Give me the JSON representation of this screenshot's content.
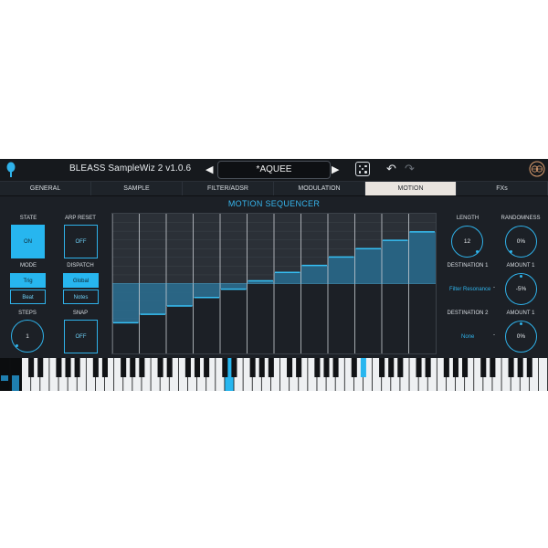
{
  "app": {
    "title": "BLEASS SampleWiz 2  v1.0.6",
    "preset_name": "*AQUEE",
    "prev_arrow": "◀",
    "next_arrow": "▶",
    "icons": [
      "logo-icon",
      "dice-icon",
      "undo-icon",
      "redo-icon",
      "brand-logo-icon"
    ],
    "accent_color": "#27b6ef"
  },
  "tabs": [
    {
      "label": "GENERAL",
      "active": false
    },
    {
      "label": "SAMPLE",
      "active": false
    },
    {
      "label": "FILTER/ADSR",
      "active": false
    },
    {
      "label": "MODULATION",
      "active": false
    },
    {
      "label": "MOTION",
      "active": true
    },
    {
      "label": "FXs",
      "active": false
    }
  ],
  "left": {
    "state_label": "STATE",
    "state_value": "ON",
    "arp_reset_label": "ARP RESET",
    "arp_reset_value": "OFF",
    "mode_label": "MODE",
    "mode_options": [
      "Trig",
      "Beat"
    ],
    "mode_selected": "Trig",
    "dispatch_label": "DISPATCH",
    "dispatch_options": [
      "Global",
      "Notes"
    ],
    "dispatch_selected": "Global",
    "steps_label": "STEPS",
    "steps_value": "1",
    "snap_label": "SNAP",
    "snap_value": "OFF"
  },
  "sequencer": {
    "title": "MOTION SEQUENCER",
    "center_line": 0.5,
    "steps": [
      0.22,
      0.28,
      0.34,
      0.4,
      0.46,
      0.52,
      0.58,
      0.63,
      0.69,
      0.75,
      0.81,
      0.87
    ]
  },
  "right": {
    "length_label": "LENGTH",
    "length_value": "12",
    "randomness_label": "RANDOMNESS",
    "randomness_value": "0%",
    "dest1_label": "DESTINATION 1",
    "dest1_value": "Filter Resonance",
    "amount1_label": "AMOUNT 1",
    "amount1_value": "-5%",
    "dest2_label": "DESTINATION 2",
    "dest2_value": "None",
    "amount2_label": "AMOUNT 1",
    "amount2_value": "0%",
    "dash": "-"
  },
  "keyboard": {
    "white_keys": 57,
    "highlighted_white": [
      22
    ],
    "highlighted_black": [
      26
    ]
  }
}
